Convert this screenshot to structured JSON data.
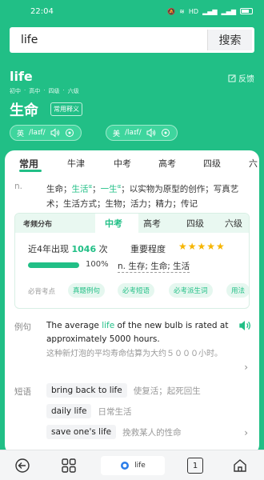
{
  "status_bar": {
    "time": "22:04",
    "icons": [
      "mute-icon",
      "alarm-icon",
      "wifi-icon",
      "hd-icon",
      "signal-icon",
      "signal-icon",
      "battery-icon"
    ],
    "hd_label": "HD"
  },
  "search": {
    "query": "life",
    "button_label": "搜索"
  },
  "header": {
    "word": "life",
    "feedback_label": "反馈",
    "levels": [
      "初中",
      "高中",
      "四级",
      "六级"
    ],
    "meaning": "生命",
    "meaning_tag": "常用释义",
    "pron_uk": {
      "label": "英",
      "ipa": "/laɪf/"
    },
    "pron_us": {
      "label": "美",
      "ipa": "/laɪf/"
    }
  },
  "dict_tabs": [
    "常用",
    "牛津",
    "中考",
    "高考",
    "四级",
    "六"
  ],
  "active_dict_tab": "常用",
  "definition": {
    "pos": "n.",
    "part1": "生命；",
    "link1": "生活",
    "sup1": "α",
    "part2": "；",
    "link2": "一生",
    "sup2": "α",
    "part3": "；以实物为原型的创作；写真艺术；生活方式；生物；活力；精力；传记"
  },
  "exam": {
    "title": "考频分布",
    "tabs": [
      "中考",
      "高考",
      "四级",
      "六级"
    ],
    "active_tab": "中考",
    "freq_prefix": "近4年出现",
    "freq_count": "1046",
    "freq_suffix": "次",
    "importance_label": "重要程度",
    "stars": 5,
    "stars_text": "★★★★★",
    "progress_percent": 100,
    "progress_label": "100%",
    "exam_def": "n. 生存; 生命; 生活",
    "must_label": "必背考点",
    "must_pills": [
      "真题例句",
      "必考短语",
      "必考派生词",
      "用法"
    ]
  },
  "example": {
    "label": "例句",
    "en_before": "The average ",
    "en_hl": "life",
    "en_after": " of the new bulb is rated at approximately 5000 hours.",
    "cn": "这种新灯泡的平均寿命估算为大约５０００小时。"
  },
  "phrases": {
    "label": "短语",
    "items": [
      {
        "en": "bring back to life",
        "cn": "使复活；起死回生"
      },
      {
        "en": "daily life",
        "cn": "日常生活"
      },
      {
        "en": "save one's life",
        "cn": "挽救某人的性命"
      }
    ]
  },
  "bottom_nav": {
    "tab_label": "life",
    "page_count": "1"
  },
  "colors": {
    "accent": "#21bf86",
    "star": "#f6b500"
  }
}
